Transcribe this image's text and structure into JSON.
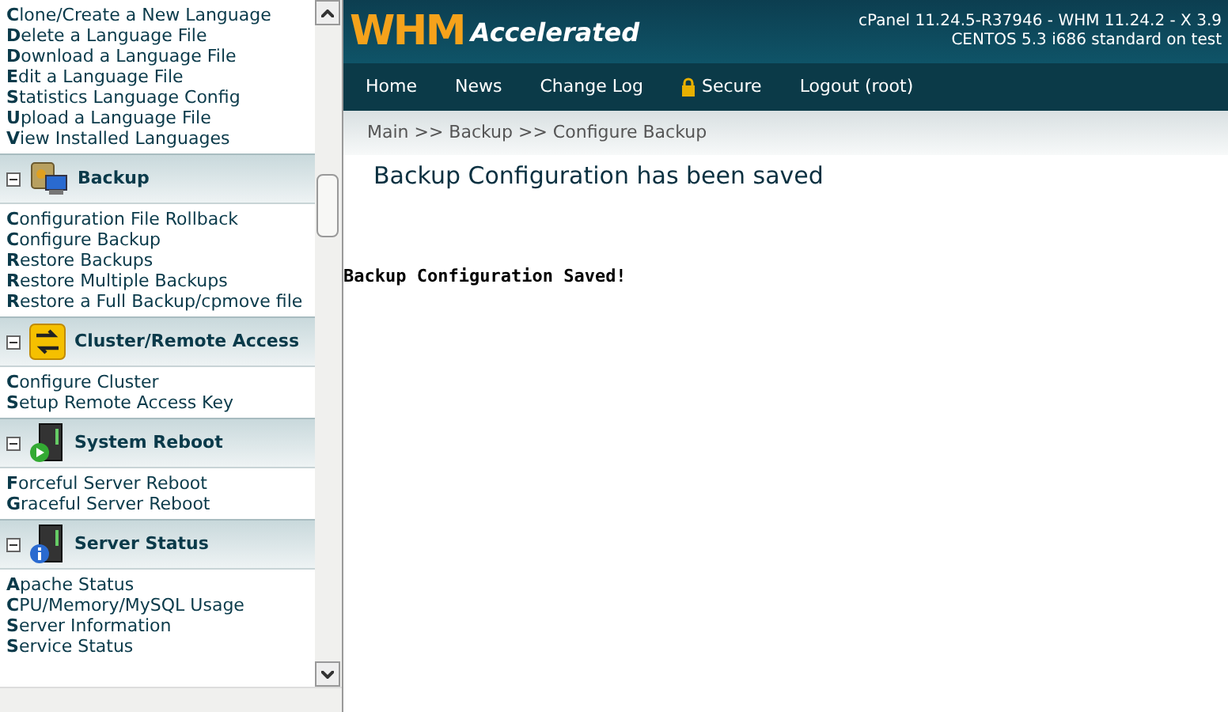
{
  "sidebar": {
    "sections": [
      {
        "kind": "plain",
        "links": [
          "**C**lone/Create a New Language",
          "**D**elete a Language File",
          "**D**ownload a Language File",
          "**E**dit a Language File",
          "**S**tatistics Language Config",
          "**U**pload a Language File",
          "**V**iew Installed Languages"
        ]
      },
      {
        "kind": "backup",
        "title": "Backup",
        "expanded": true,
        "links": [
          "**C**onfiguration File Rollback",
          "**C**onfigure Backup",
          "**R**estore Backups",
          "**R**estore Multiple Backups",
          "**R**estore a Full Backup/cpmove file"
        ]
      },
      {
        "kind": "cluster",
        "title": "Cluster/Remote Access",
        "expanded": true,
        "links": [
          "**C**onfigure Cluster",
          "**S**etup Remote Access Key"
        ]
      },
      {
        "kind": "reboot",
        "title": "System Reboot",
        "expanded": true,
        "links": [
          "**F**orceful Server Reboot",
          "**G**raceful Server Reboot"
        ]
      },
      {
        "kind": "status",
        "title": "Server Status",
        "expanded": true,
        "links": [
          "**A**pache Status",
          "**C**PU/Memory/MySQL Usage",
          "**S**erver Information",
          "**S**ervice Status"
        ]
      }
    ]
  },
  "header": {
    "logo_main": "WHM",
    "logo_sub": "Accelerated",
    "version_line": "cPanel 11.24.5-R37946 - WHM 11.24.2 - X 3.9",
    "server_line": "CENTOS 5.3 i686 standard on test"
  },
  "nav": [
    {
      "label": "Home",
      "kind": "plain"
    },
    {
      "label": "News",
      "kind": "plain"
    },
    {
      "label": "Change Log",
      "kind": "plain"
    },
    {
      "label": "Secure",
      "kind": "lock"
    },
    {
      "label": "Logout (root)",
      "kind": "plain"
    }
  ],
  "breadcrumb": "Main >> Backup >> Configure Backup",
  "page_title": "Backup Configuration has been saved",
  "message": "Backup Configuration Saved!"
}
